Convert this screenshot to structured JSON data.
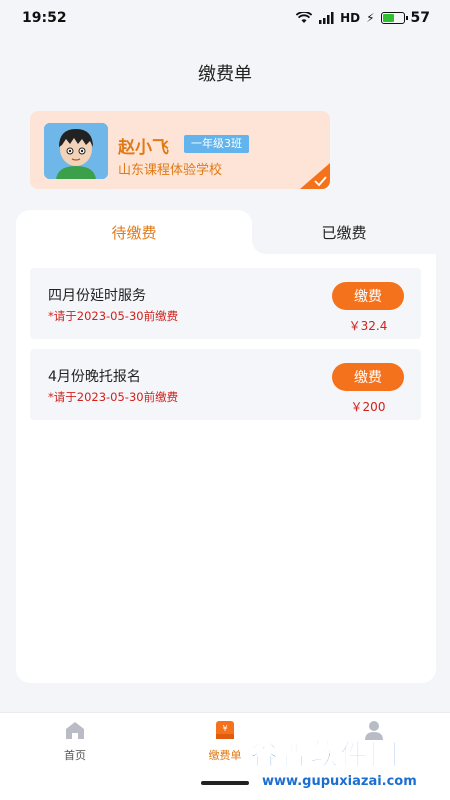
{
  "status_bar": {
    "time": "19:52",
    "battery": "57",
    "network": "4G",
    "network_label": "HD",
    "charging_glyph": "⚡",
    "signal_icon": "signal-bars",
    "wifi_icon": "wifi-icon",
    "battery_fraction": 0.57
  },
  "header": {
    "title": "缴费单"
  },
  "student": {
    "name": "赵小飞",
    "class_badge": "一年级3班",
    "school": "山东课程体验学校"
  },
  "tabs": [
    {
      "label": "待缴费",
      "active": true
    },
    {
      "label": "已缴费",
      "active": false
    }
  ],
  "fees": [
    {
      "title": "四月份延时服务",
      "due": "*请于2023-05-30前缴费",
      "button": "缴费",
      "amount": "￥32.4"
    },
    {
      "title": "4月份晚托报名",
      "due": "*请于2023-05-30前缴费",
      "button": "缴费",
      "amount": "￥200"
    }
  ],
  "bottom_nav": [
    {
      "label": "首页",
      "icon": "home-icon",
      "active": false
    },
    {
      "label": "缴费单",
      "icon": "bill-icon",
      "active": true
    },
    {
      "label": "",
      "icon": "user-icon",
      "active": false
    }
  ],
  "watermark": {
    "title": "谷普软件园",
    "url": "www.gupuxiazai.com"
  },
  "colors": {
    "accent": "#f5721d",
    "accent_text": "#e07a17",
    "warning": "#d0211b",
    "badge": "#63b4ec",
    "card_bg": "#fde4d7"
  }
}
